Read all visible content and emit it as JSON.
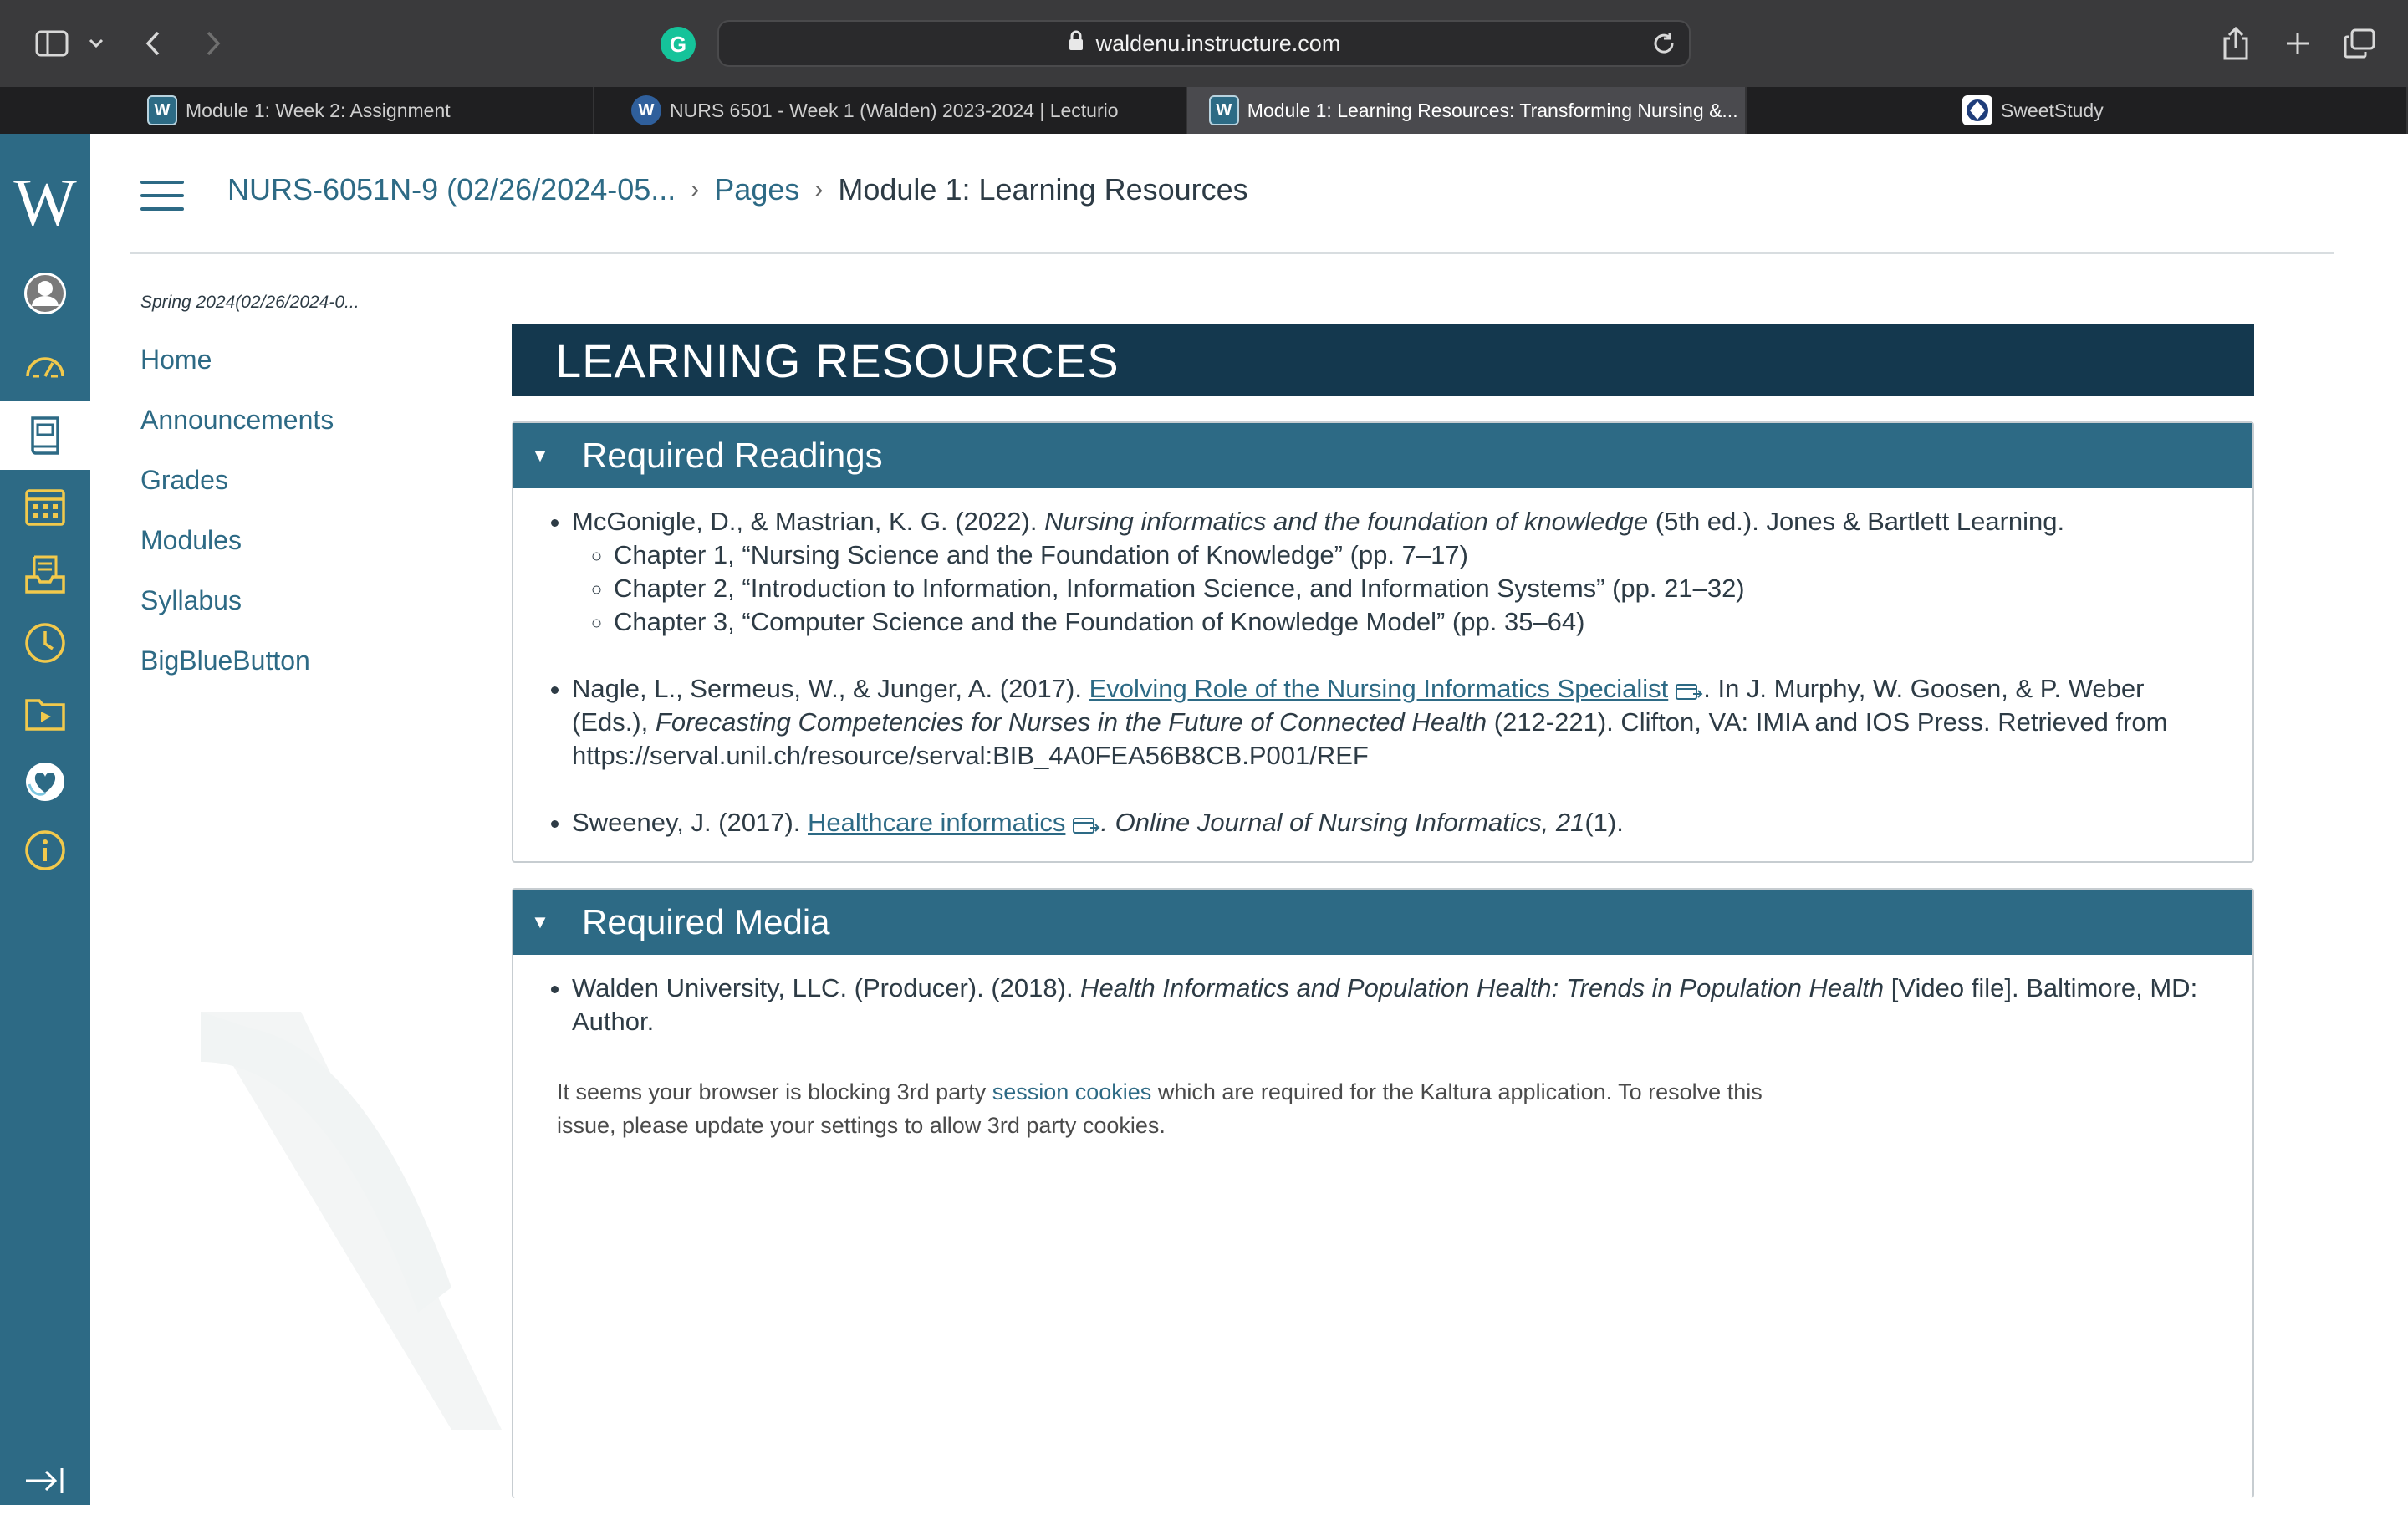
{
  "browser": {
    "url": "waldenu.instructure.com",
    "tabs": [
      {
        "title": "Module 1: Week 2: Assignment",
        "favicon": "walden-w-icon"
      },
      {
        "title": "NURS 6501 - Week 1 (Walden) 2023-2024 | Lecturio",
        "favicon": "lecturio-icon"
      },
      {
        "title": "Module 1: Learning Resources: Transforming Nursing &...",
        "favicon": "walden-w-icon"
      },
      {
        "title": "SweetStudy",
        "favicon": "sweetstudy-icon"
      }
    ]
  },
  "global_nav": {
    "logo": "W",
    "items": [
      "account-icon",
      "dashboard-icon",
      "courses-icon",
      "calendar-icon",
      "inbox-icon",
      "history-icon",
      "studio-icon",
      "wellness-icon",
      "help-icon"
    ],
    "collapse_icon": "collapse-nav-icon"
  },
  "breadcrumb": {
    "course": "NURS-6051N-9 (02/26/2024-05...",
    "pages": "Pages",
    "current": "Module 1: Learning Resources"
  },
  "course_nav": {
    "term": "Spring 2024(02/26/2024-0...",
    "links": [
      "Home",
      "Announcements",
      "Grades",
      "Modules",
      "Syllabus",
      "BigBlueButton"
    ]
  },
  "content": {
    "banner": "LEARNING RESOURCES",
    "readings_title": "Required Readings",
    "readings": {
      "r1_authors": "McGonigle, D., & Mastrian, K. G. (2022). ",
      "r1_title": "Nursing informatics and the foundation of knowledge",
      "r1_rest": " (5th ed.). Jones & Bartlett Learning.",
      "r1_ch1": "Chapter 1, “Nursing Science and the Foundation of Knowledge” (pp. 7–17)",
      "r1_ch2": "Chapter 2, “Introduction to Information, Information Science, and Information Systems” (pp. 21–32)",
      "r1_ch3": "Chapter 3, “Computer Science and the Foundation of Knowledge Model” (pp. 35–64)",
      "r2_authors": "Nagle, L., Sermeus, W., & Junger, A. (2017).  ",
      "r2_link": "Evolving Role of the Nursing Informatics Specialist",
      "r2_mid": ". In J. Murphy, W. Goosen, &  P. Weber (Eds.), ",
      "r2_book": "Forecasting Competencies for Nurses in the Future of Connected Health",
      "r2_rest": " (212-221). Clifton, VA: IMIA and IOS Press. Retrieved from https://serval.unil.ch/resource/serval:BIB_4A0FEA56B8CB.P001/REF",
      "r3_authors": "Sweeney, J. (2017). ",
      "r3_link": "Healthcare informatics",
      "r3_journal": ". Online Journal of Nursing Informatics, 21",
      "r3_rest": "(1)."
    },
    "media_title": "Required Media",
    "media": {
      "m1_authors": "Walden University, LLC. (Producer). (2018). ",
      "m1_title": "Health Informatics and Population Health: Trends in Population Health",
      "m1_rest": " [Video file]. Baltimore, MD: Author."
    },
    "kaltura": {
      "before": "It seems your browser is blocking 3rd party ",
      "link": "session cookies",
      "after": " which are required for the Kaltura application. To resolve this issue, please update your settings to allow 3rd party cookies."
    }
  }
}
